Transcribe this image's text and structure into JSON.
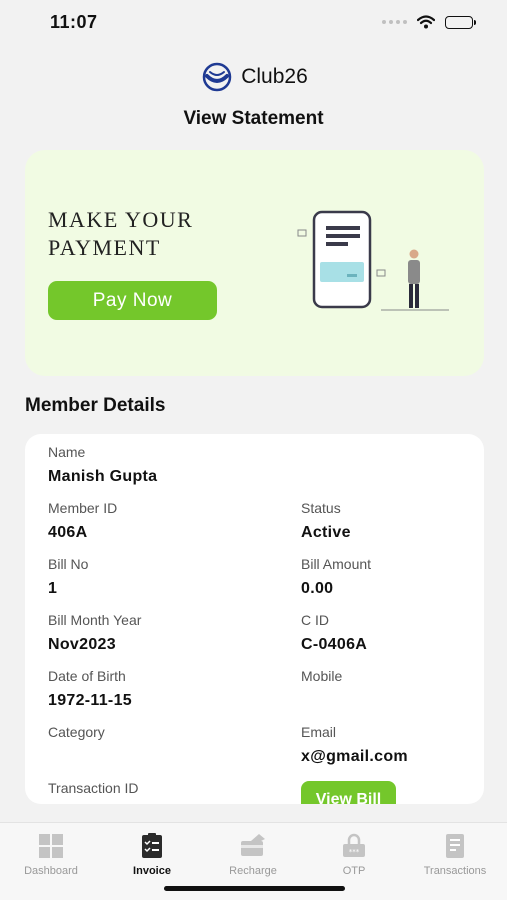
{
  "status_bar": {
    "time": "11:07"
  },
  "header": {
    "brand": "Club26",
    "title": "View Statement"
  },
  "promo": {
    "title_line1": "Make your",
    "title_line2": "payment",
    "button_label": "Pay Now"
  },
  "member_section": {
    "title": "Member Details"
  },
  "member": {
    "name_label": "Name",
    "name": "Manish Gupta",
    "member_id_label": "Member ID",
    "member_id": "406A",
    "status_label": "Status",
    "status": "Active",
    "bill_no_label": "Bill No",
    "bill_no": "1",
    "bill_amount_label": "Bill Amount",
    "bill_amount": "0.00",
    "bill_month_label": "Bill Month Year",
    "bill_month": "Nov2023",
    "cid_label": "C ID",
    "cid": "C-0406A",
    "dob_label": "Date of Birth",
    "dob": "1972-11-15",
    "mobile_label": "Mobile",
    "mobile": "",
    "category_label": "Category",
    "category": "",
    "email_label": "Email",
    "email": "x@gmail.com",
    "transaction_id_label": "Transaction ID",
    "transaction_id": "",
    "view_bill_label": "View Bill"
  },
  "nav": {
    "items": [
      {
        "label": "Dashboard",
        "icon": "dashboard-icon",
        "active": false
      },
      {
        "label": "Invoice",
        "icon": "invoice-icon",
        "active": true
      },
      {
        "label": "Recharge",
        "icon": "recharge-icon",
        "active": false
      },
      {
        "label": "OTP",
        "icon": "otp-icon",
        "active": false
      },
      {
        "label": "Transactions",
        "icon": "transactions-icon",
        "active": false
      }
    ]
  },
  "colors": {
    "accent": "#74c72b",
    "promo_bg": "#f1fbe3",
    "page_bg": "#f2f2f2",
    "brand_blue": "#1f3a93"
  }
}
